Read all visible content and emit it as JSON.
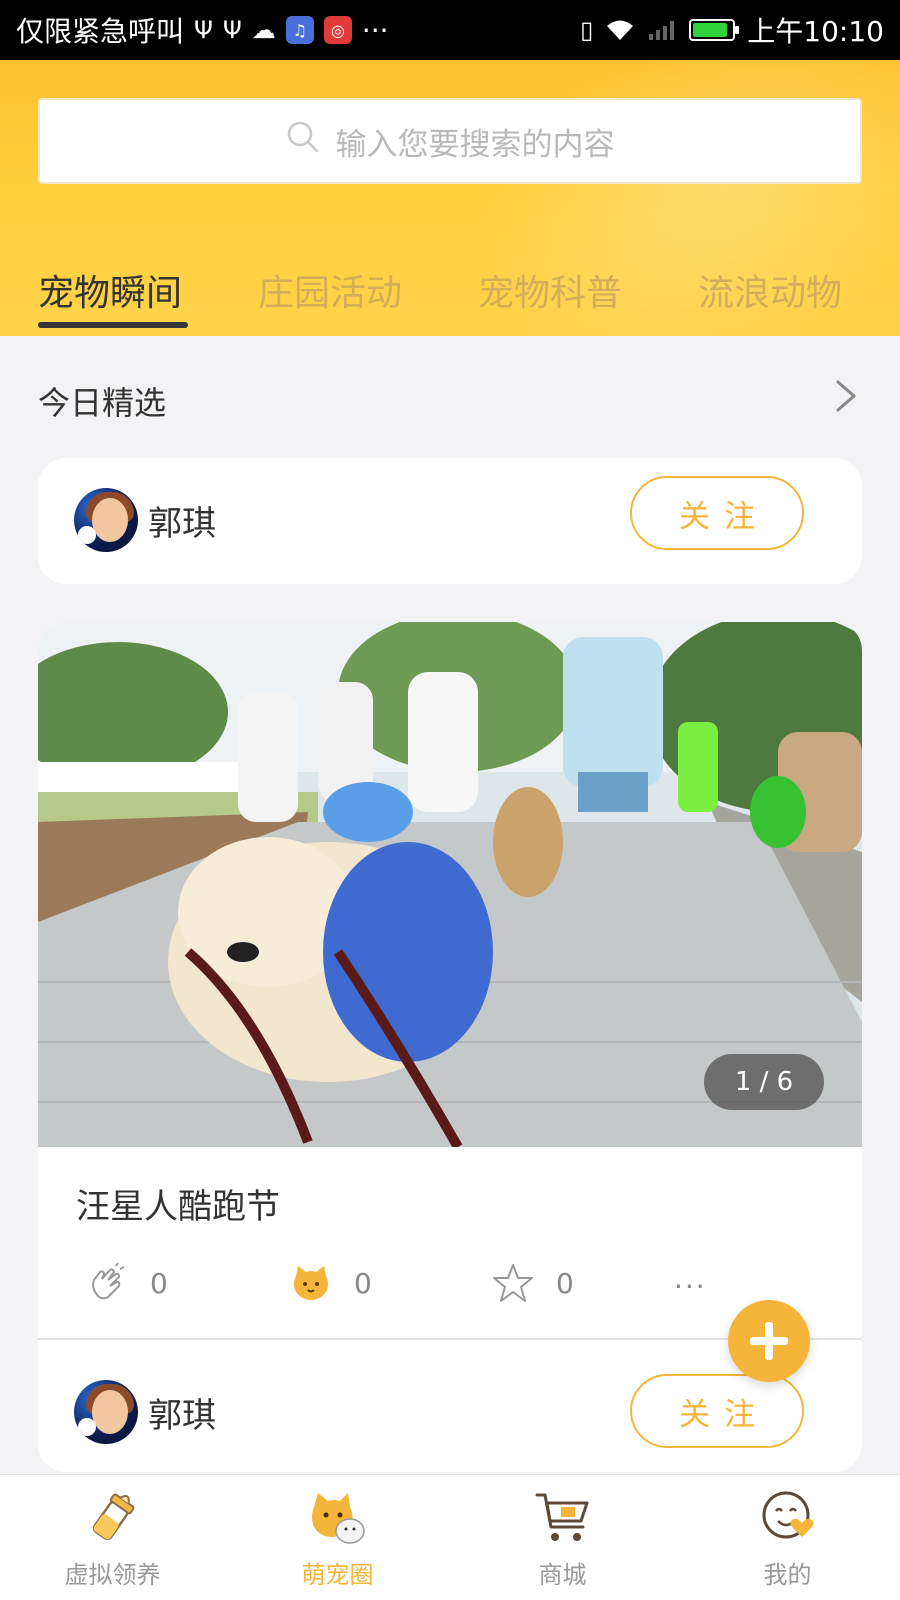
{
  "status_bar": {
    "carrier_text": "仅限紧急呼叫",
    "time": "上午10:10",
    "overflow": "···",
    "battery_level": 0.9
  },
  "header": {
    "search": {
      "placeholder": "输入您要搜索的内容",
      "icon": "search-icon"
    },
    "tabs": [
      {
        "label": "宠物瞬间",
        "active": true
      },
      {
        "label": "庄园活动",
        "active": false
      },
      {
        "label": "宠物科普",
        "active": false
      },
      {
        "label": "流浪动物",
        "active": false
      }
    ]
  },
  "main": {
    "section_title": "今日精选",
    "posts": [
      {
        "author": "郭琪",
        "follow_label": "关注"
      },
      {
        "title": "汪星人酷跑节",
        "image_counter": "1 / 6",
        "likes": "0",
        "comments": "0",
        "favorites": "0",
        "more": "···"
      },
      {
        "author": "郭琪",
        "follow_label": "关注"
      }
    ]
  },
  "bottom_nav": {
    "items": [
      {
        "label": "虚拟领养",
        "icon": "milk-bottle-icon",
        "active": false
      },
      {
        "label": "萌宠圈",
        "icon": "pets-icon",
        "active": true
      },
      {
        "label": "商城",
        "icon": "shopping-cart-icon",
        "active": false
      },
      {
        "label": "我的",
        "icon": "smiley-heart-icon",
        "active": false
      }
    ]
  },
  "colors": {
    "accent": "#f5b53a",
    "header_yellow": "#ffc22e",
    "text_dark": "#333333",
    "text_muted": "#999999"
  }
}
